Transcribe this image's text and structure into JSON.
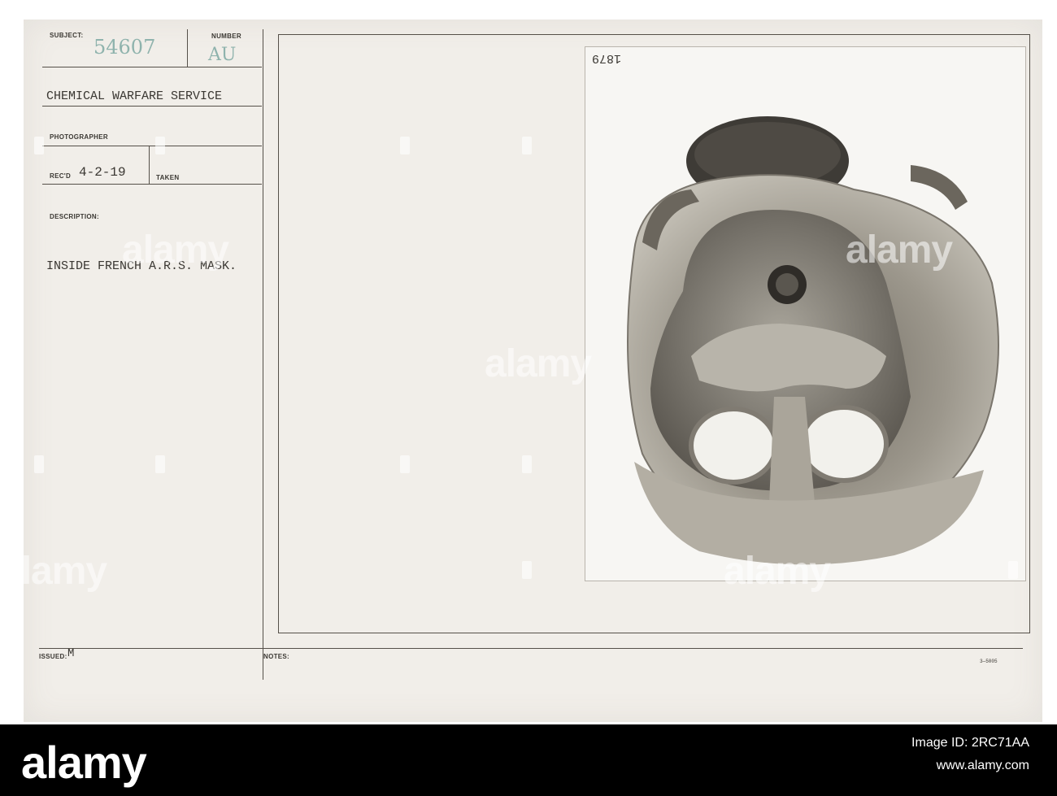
{
  "card": {
    "subject_label": "SUBJECT:",
    "subject_number": "54607",
    "number_label": "NUMBER",
    "number_stamp": "AU",
    "service": "CHEMICAL WARFARE SERVICE",
    "photographer_label": "PHOTOGRAPHER",
    "recd_label": "REC'D",
    "recd_date": "4-2-19",
    "taken_label": "TAKEN",
    "description_label": "DESCRIPTION:",
    "description": "INSIDE FRENCH A.R.S. MASK.",
    "issued_label": "ISSUED:",
    "issued_value": "M",
    "notes_label": "NOTES:",
    "form_code": "3—5005"
  },
  "photo": {
    "negative_number": "1879",
    "subject_icon": "gas-mask-photo"
  },
  "watermark": {
    "text": "alamy"
  },
  "footer": {
    "logo": "alamy",
    "image_id_label": "Image ID: 2RC71AA",
    "url": "www.alamy.com"
  },
  "colors": {
    "card": "#f1eee9",
    "ink": "#3a3732",
    "stamp": "#8fb3ad",
    "band": "#000000"
  }
}
